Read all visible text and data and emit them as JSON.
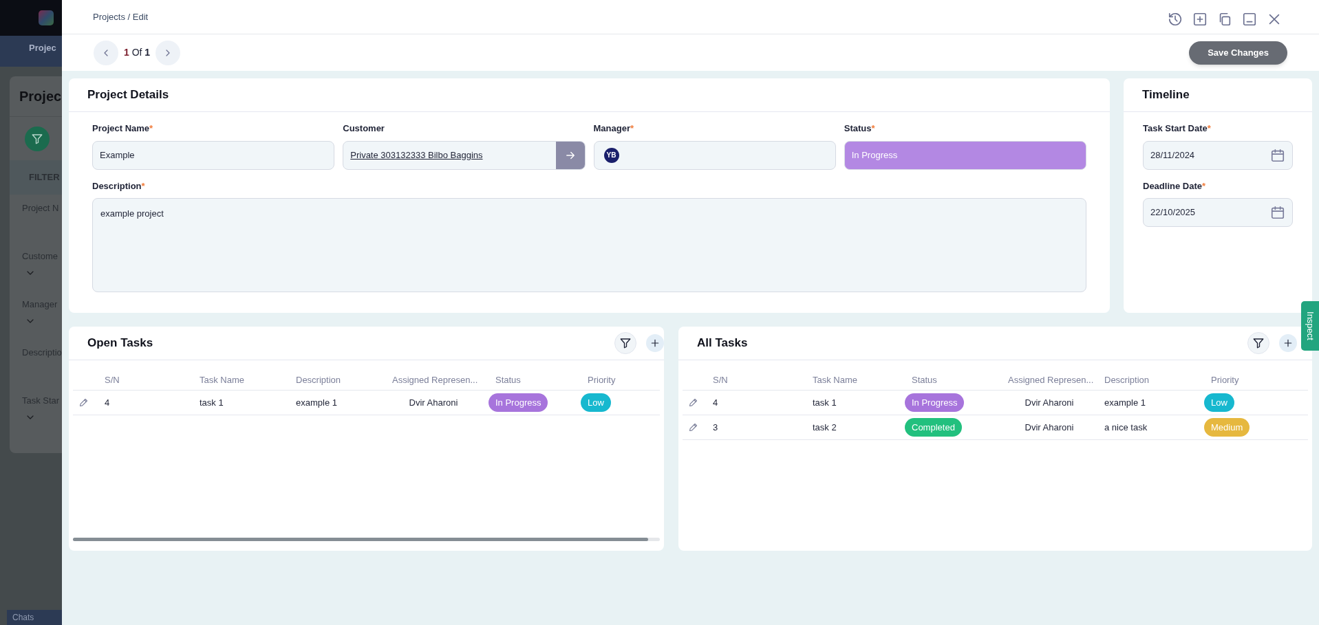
{
  "background": {
    "nav_tab": "Projec",
    "page_title": "Projec",
    "filters_heading": "FILTER",
    "filter_labels": [
      "Project N",
      "Custome",
      "Manager",
      "Descriptio",
      "Task Star"
    ],
    "chats": "Chats"
  },
  "header": {
    "breadcrumb": "Projects / Edit",
    "pager": {
      "current": "1",
      "separator": "Of",
      "total": "1"
    },
    "save_button": "Save Changes"
  },
  "project_details": {
    "title": "Project Details",
    "fields": [
      {
        "kind": "text",
        "label": "Project Name",
        "required_mark": "*",
        "value": "Example"
      },
      {
        "kind": "link",
        "label": "Customer",
        "value": "Private 303132333 Bilbo Baggins"
      },
      {
        "kind": "avatar",
        "label": "Manager",
        "required_mark": "*",
        "value": "YB"
      },
      {
        "kind": "status",
        "label": "Status",
        "required_mark": "*",
        "value": "In Progress",
        "color": "#b388e3"
      }
    ],
    "description": {
      "label": "Description",
      "required_mark": "*",
      "value": "example project"
    }
  },
  "timeline": {
    "title": "Timeline",
    "fields": [
      {
        "label": "Task Start Date",
        "required_mark": "*",
        "value": "28/11/2024"
      },
      {
        "label": "Deadline Date",
        "required_mark": "*",
        "value": "22/10/2025"
      }
    ]
  },
  "open_tasks": {
    "title": "Open Tasks",
    "columns": [
      {
        "label": "S/N",
        "kind": "text"
      },
      {
        "label": "Task Name",
        "kind": "text"
      },
      {
        "label": "Description",
        "kind": "text"
      },
      {
        "label": "Assigned Represen...",
        "kind": "center"
      },
      {
        "label": "Status",
        "kind": "badge"
      },
      {
        "label": "Priority",
        "kind": "badge"
      }
    ],
    "rows": [
      [
        {
          "text": "4"
        },
        {
          "text": "task 1"
        },
        {
          "text": "example 1"
        },
        {
          "text": "Dvir Aharoni"
        },
        {
          "text": "In Progress",
          "color": "#a774dc"
        },
        {
          "text": "Low",
          "color": "#17b8cf"
        }
      ]
    ]
  },
  "all_tasks": {
    "title": "All Tasks",
    "columns": [
      {
        "label": "S/N",
        "kind": "text"
      },
      {
        "label": "Task Name",
        "kind": "text"
      },
      {
        "label": "Status",
        "kind": "badge"
      },
      {
        "label": "Assigned Represen...",
        "kind": "center"
      },
      {
        "label": "Description",
        "kind": "text"
      },
      {
        "label": "Priority",
        "kind": "badge"
      }
    ],
    "rows": [
      [
        {
          "text": "4"
        },
        {
          "text": "task 1"
        },
        {
          "text": "In Progress",
          "color": "#a774dc"
        },
        {
          "text": "Dvir Aharoni"
        },
        {
          "text": "example 1"
        },
        {
          "text": "Low",
          "color": "#17b8cf"
        }
      ],
      [
        {
          "text": "3"
        },
        {
          "text": "task 2"
        },
        {
          "text": "Completed",
          "color": "#22c07e"
        },
        {
          "text": "Dvir Aharoni"
        },
        {
          "text": "a nice task"
        },
        {
          "text": "Medium",
          "color": "#e6b83f"
        }
      ]
    ]
  },
  "inspect_tab": "Inspect"
}
